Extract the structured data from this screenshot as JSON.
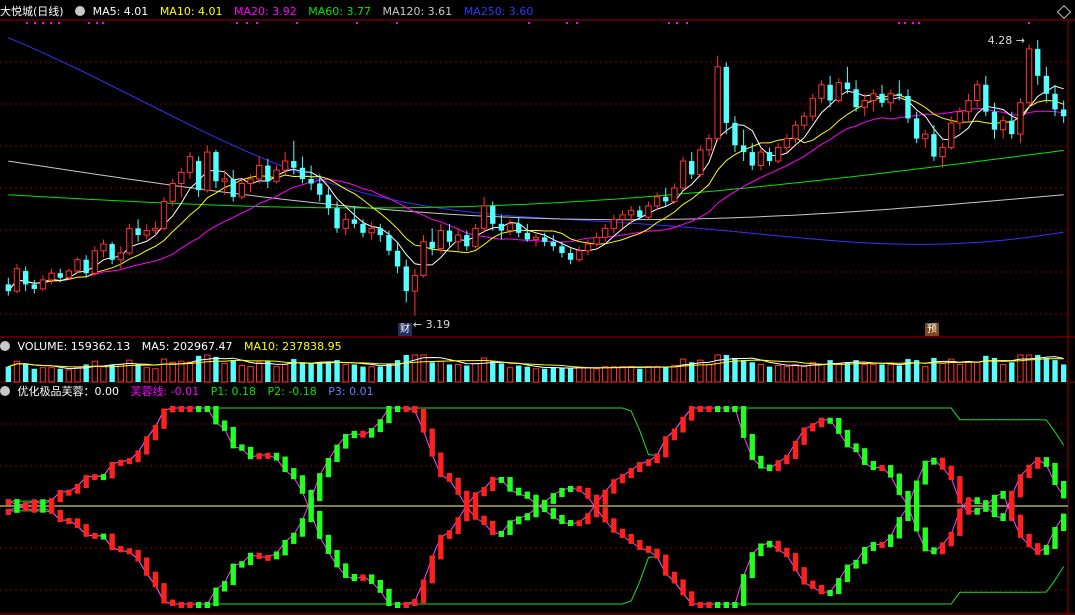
{
  "main_legend": {
    "stock": "大悦城(日线)",
    "ma5": "MA5: 4.01",
    "ma10": "MA10: 4.01",
    "ma20": "MA20: 3.92",
    "ma60": "MA60: 3.77",
    "ma120": "MA120: 3.61",
    "ma250": "MA250: 3.60"
  },
  "volume_legend": {
    "volume": "VOLUME: 159362.13",
    "ma5": "MA5: 202967.47",
    "ma10": "MA10: 237838.95"
  },
  "indicator_legend": {
    "name": "优化极品芙蓉：0.00",
    "line": "芙蓉线: -0.01",
    "p1": "P1: 0.18",
    "p2": "P2: -0.18",
    "p3": "P3: 0.01"
  },
  "annotations": {
    "high": "4.28",
    "low": "3.19",
    "marker_cai": "财",
    "marker_yu": "预"
  },
  "colors": {
    "up": "#ff3232",
    "down": "#54ffff",
    "ma5": "#ffffff",
    "ma10": "#ffff00",
    "ma20": "#ff00ff",
    "ma60": "#00e600",
    "ma120": "#c8c8c8",
    "ma250": "#3232ff",
    "grid": "#7a0000",
    "ind_up": "#ff2020",
    "ind_down": "#20ff20"
  },
  "chart_data": {
    "type": "candlestick",
    "candles": [
      [
        3.33,
        3.36,
        3.28,
        3.3
      ],
      [
        3.3,
        3.42,
        3.29,
        3.4
      ],
      [
        3.39,
        3.41,
        3.3,
        3.33
      ],
      [
        3.33,
        3.35,
        3.29,
        3.31
      ],
      [
        3.31,
        3.37,
        3.3,
        3.35
      ],
      [
        3.35,
        3.4,
        3.33,
        3.38
      ],
      [
        3.38,
        3.4,
        3.34,
        3.36
      ],
      [
        3.36,
        3.4,
        3.35,
        3.39
      ],
      [
        3.39,
        3.45,
        3.38,
        3.44
      ],
      [
        3.44,
        3.46,
        3.36,
        3.38
      ],
      [
        3.38,
        3.5,
        3.37,
        3.48
      ],
      [
        3.48,
        3.53,
        3.45,
        3.51
      ],
      [
        3.51,
        3.52,
        3.42,
        3.44
      ],
      [
        3.44,
        3.5,
        3.4,
        3.47
      ],
      [
        3.47,
        3.6,
        3.46,
        3.58
      ],
      [
        3.58,
        3.62,
        3.52,
        3.55
      ],
      [
        3.55,
        3.6,
        3.53,
        3.57
      ],
      [
        3.57,
        3.61,
        3.55,
        3.58
      ],
      [
        3.58,
        3.72,
        3.57,
        3.7
      ],
      [
        3.7,
        3.8,
        3.68,
        3.78
      ],
      [
        3.78,
        3.85,
        3.72,
        3.83
      ],
      [
        3.83,
        3.92,
        3.8,
        3.9
      ],
      [
        3.88,
        3.9,
        3.72,
        3.75
      ],
      [
        3.75,
        3.95,
        3.74,
        3.92
      ],
      [
        3.92,
        3.93,
        3.76,
        3.79
      ],
      [
        3.79,
        3.84,
        3.73,
        3.8
      ],
      [
        3.8,
        3.84,
        3.7,
        3.72
      ],
      [
        3.72,
        3.8,
        3.71,
        3.78
      ],
      [
        3.78,
        3.82,
        3.74,
        3.8
      ],
      [
        3.8,
        3.9,
        3.78,
        3.86
      ],
      [
        3.86,
        3.89,
        3.76,
        3.79
      ],
      [
        3.79,
        3.86,
        3.78,
        3.84
      ],
      [
        3.84,
        3.92,
        3.82,
        3.88
      ],
      [
        3.88,
        3.97,
        3.82,
        3.85
      ],
      [
        3.85,
        3.9,
        3.78,
        3.8
      ],
      [
        3.8,
        3.86,
        3.75,
        3.78
      ],
      [
        3.78,
        3.82,
        3.7,
        3.73
      ],
      [
        3.73,
        3.76,
        3.64,
        3.67
      ],
      [
        3.67,
        3.7,
        3.56,
        3.58
      ],
      [
        3.58,
        3.65,
        3.55,
        3.62
      ],
      [
        3.62,
        3.68,
        3.58,
        3.6
      ],
      [
        3.6,
        3.62,
        3.54,
        3.56
      ],
      [
        3.56,
        3.61,
        3.53,
        3.58
      ],
      [
        3.58,
        3.6,
        3.52,
        3.55
      ],
      [
        3.55,
        3.57,
        3.46,
        3.48
      ],
      [
        3.48,
        3.52,
        3.38,
        3.41
      ],
      [
        3.41,
        3.44,
        3.25,
        3.3
      ],
      [
        3.3,
        3.4,
        3.19,
        3.37
      ],
      [
        3.37,
        3.55,
        3.36,
        3.52
      ],
      [
        3.52,
        3.58,
        3.46,
        3.49
      ],
      [
        3.49,
        3.6,
        3.47,
        3.57
      ],
      [
        3.57,
        3.6,
        3.5,
        3.52
      ],
      [
        3.52,
        3.58,
        3.48,
        3.55
      ],
      [
        3.55,
        3.57,
        3.48,
        3.5
      ],
      [
        3.5,
        3.6,
        3.49,
        3.58
      ],
      [
        3.58,
        3.72,
        3.56,
        3.68
      ],
      [
        3.68,
        3.7,
        3.57,
        3.6
      ],
      [
        3.6,
        3.64,
        3.53,
        3.57
      ],
      [
        3.57,
        3.62,
        3.55,
        3.6
      ],
      [
        3.6,
        3.63,
        3.54,
        3.56
      ],
      [
        3.56,
        3.6,
        3.52,
        3.53
      ],
      [
        3.53,
        3.56,
        3.5,
        3.54
      ],
      [
        3.54,
        3.56,
        3.5,
        3.52
      ],
      [
        3.52,
        3.55,
        3.48,
        3.5
      ],
      [
        3.5,
        3.52,
        3.45,
        3.47
      ],
      [
        3.47,
        3.49,
        3.42,
        3.44
      ],
      [
        3.44,
        3.5,
        3.43,
        3.48
      ],
      [
        3.48,
        3.53,
        3.46,
        3.51
      ],
      [
        3.51,
        3.56,
        3.5,
        3.54
      ],
      [
        3.54,
        3.6,
        3.52,
        3.58
      ],
      [
        3.58,
        3.64,
        3.56,
        3.62
      ],
      [
        3.62,
        3.66,
        3.58,
        3.64
      ],
      [
        3.64,
        3.68,
        3.6,
        3.66
      ],
      [
        3.66,
        3.68,
        3.62,
        3.63
      ],
      [
        3.63,
        3.7,
        3.62,
        3.68
      ],
      [
        3.68,
        3.74,
        3.66,
        3.72
      ],
      [
        3.72,
        3.76,
        3.68,
        3.7
      ],
      [
        3.7,
        3.78,
        3.69,
        3.76
      ],
      [
        3.76,
        3.9,
        3.75,
        3.88
      ],
      [
        3.88,
        3.92,
        3.8,
        3.82
      ],
      [
        3.82,
        3.95,
        3.81,
        3.93
      ],
      [
        3.93,
        4.0,
        3.9,
        3.98
      ],
      [
        3.98,
        4.35,
        3.97,
        4.3
      ],
      [
        4.3,
        4.32,
        4.0,
        4.05
      ],
      [
        4.05,
        4.08,
        3.92,
        3.95
      ],
      [
        3.95,
        4.02,
        3.88,
        3.92
      ],
      [
        3.92,
        3.96,
        3.84,
        3.86
      ],
      [
        3.86,
        3.94,
        3.84,
        3.92
      ],
      [
        3.92,
        3.94,
        3.86,
        3.88
      ],
      [
        3.88,
        3.96,
        3.87,
        3.94
      ],
      [
        3.94,
        4.0,
        3.92,
        3.98
      ],
      [
        3.98,
        4.06,
        3.96,
        4.04
      ],
      [
        4.04,
        4.1,
        4.02,
        4.08
      ],
      [
        4.08,
        4.18,
        4.06,
        4.16
      ],
      [
        4.16,
        4.24,
        4.14,
        4.22
      ],
      [
        4.22,
        4.26,
        4.12,
        4.15
      ],
      [
        4.15,
        4.25,
        4.14,
        4.23
      ],
      [
        4.23,
        4.3,
        4.18,
        4.2
      ],
      [
        4.2,
        4.24,
        4.1,
        4.12
      ],
      [
        4.12,
        4.18,
        4.08,
        4.15
      ],
      [
        4.15,
        4.2,
        4.1,
        4.18
      ],
      [
        4.18,
        4.22,
        4.12,
        4.14
      ],
      [
        4.14,
        4.2,
        4.1,
        4.18
      ],
      [
        4.18,
        4.24,
        4.15,
        4.17
      ],
      [
        4.17,
        4.2,
        4.05,
        4.07
      ],
      [
        4.07,
        4.1,
        3.96,
        3.98
      ],
      [
        3.98,
        4.02,
        3.94,
        4.0
      ],
      [
        4.0,
        4.04,
        3.88,
        3.9
      ],
      [
        3.9,
        3.96,
        3.85,
        3.94
      ],
      [
        3.94,
        4.08,
        3.93,
        4.05
      ],
      [
        4.05,
        4.12,
        4.02,
        4.1
      ],
      [
        4.1,
        4.18,
        4.06,
        4.15
      ],
      [
        4.15,
        4.24,
        4.12,
        4.22
      ],
      [
        4.22,
        4.26,
        4.08,
        4.1
      ],
      [
        4.1,
        4.14,
        3.98,
        4.02
      ],
      [
        4.02,
        4.08,
        3.98,
        4.06
      ],
      [
        4.06,
        4.1,
        3.98,
        4.0
      ],
      [
        4.0,
        4.16,
        3.96,
        4.14
      ],
      [
        4.14,
        4.4,
        4.12,
        4.38
      ],
      [
        4.38,
        4.42,
        4.22,
        4.26
      ],
      [
        4.26,
        4.3,
        4.14,
        4.18
      ],
      [
        4.18,
        4.22,
        4.08,
        4.11
      ],
      [
        4.11,
        4.15,
        4.05,
        4.08
      ]
    ]
  }
}
